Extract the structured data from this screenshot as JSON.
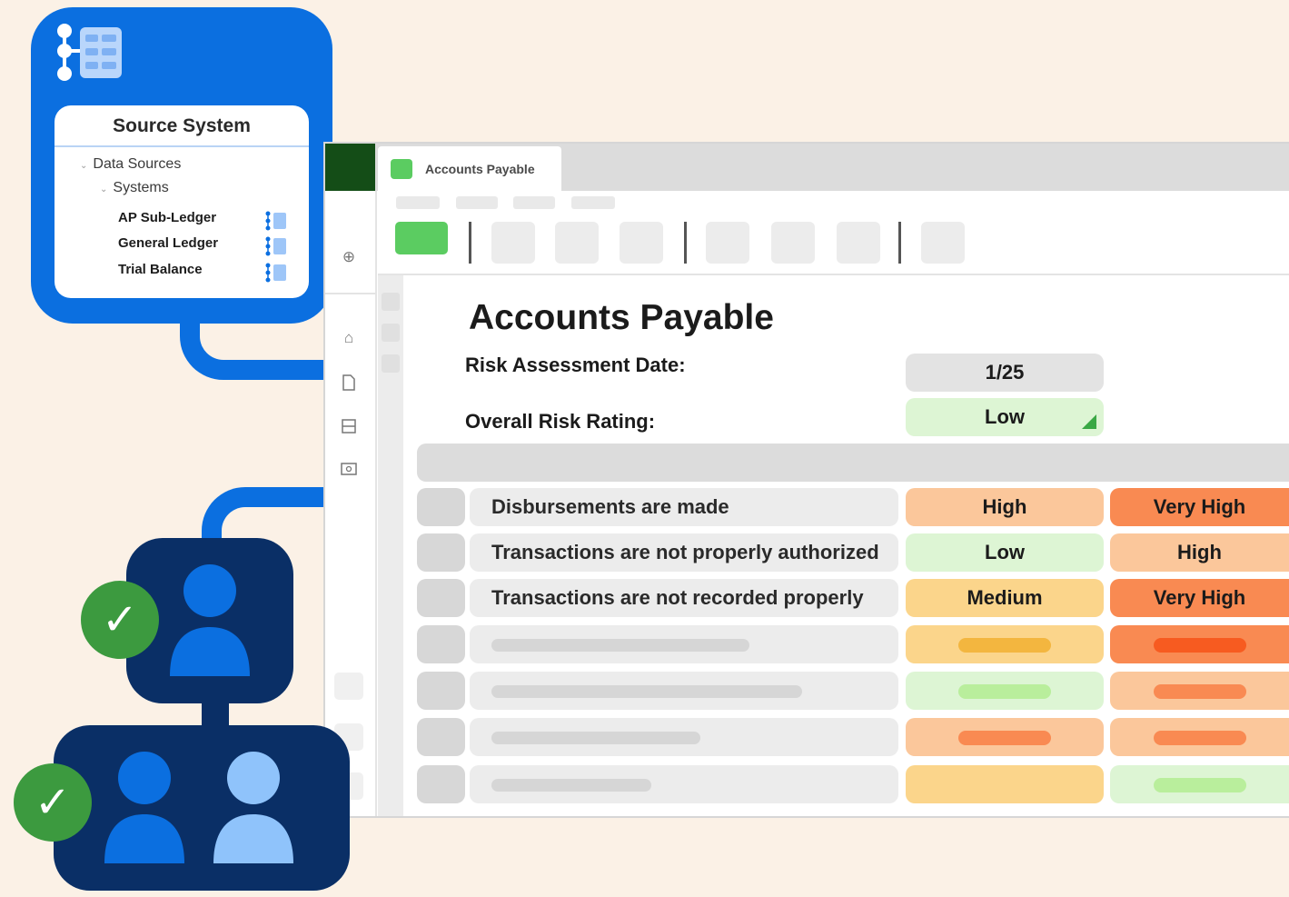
{
  "source_system": {
    "title": "Source System",
    "tree": {
      "root": "Data Sources",
      "child": "Systems",
      "items": [
        "AP Sub-Ledger",
        "General Ledger",
        "Trial Balance"
      ]
    }
  },
  "window": {
    "tab_label": "Accounts Payable"
  },
  "page": {
    "title": "Accounts Payable",
    "risk_date_label": "Risk Assessment Date:",
    "risk_date_value": "1/25",
    "overall_label": "Overall Risk Rating:",
    "overall_value": "Low"
  },
  "risks": [
    {
      "label": "Disbursements are made",
      "col1": "High",
      "col2": "Very High"
    },
    {
      "label": "Transactions are not properly authorized",
      "col1": "Low",
      "col2": "High"
    },
    {
      "label": "Transactions are not recorded properly",
      "col1": "Medium",
      "col2": "Very High"
    }
  ],
  "colors": {
    "brand_blue": "#0b6fe0",
    "navy": "#0a2f66",
    "low": "#ddf5d4",
    "medium": "#fbd58b",
    "high": "#fbc79b",
    "very_high": "#f98a52",
    "check_green": "#3c9a3f"
  },
  "icons": [
    "hierarchy-icon",
    "table-icon",
    "add-icon",
    "home-icon",
    "file-icon",
    "inbox-icon",
    "folder-icon",
    "check-icon",
    "person-icon"
  ]
}
